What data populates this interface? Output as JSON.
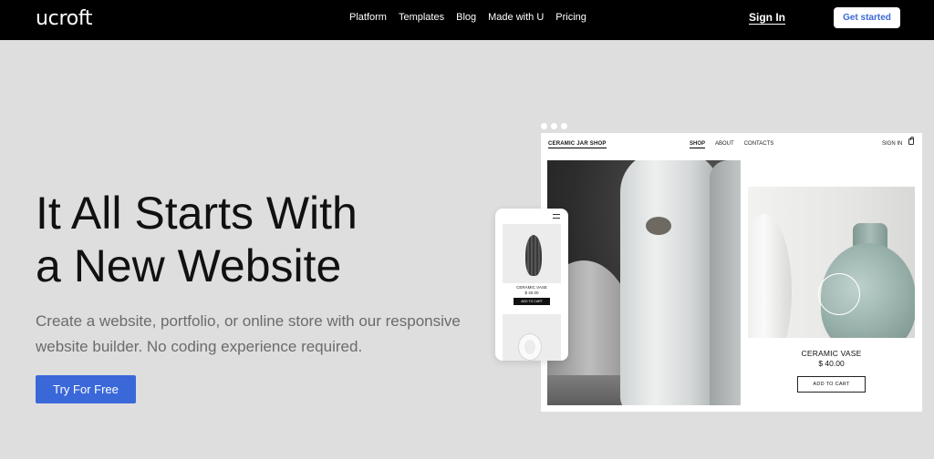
{
  "header": {
    "logo": "ucroft",
    "nav": [
      "Platform",
      "Templates",
      "Blog",
      "Made with U",
      "Pricing"
    ],
    "sign_in": "Sign In",
    "get_started": "Get started"
  },
  "hero": {
    "headline_line1": "It All Starts With",
    "headline_line2": "a New Website",
    "subtext": "Create a website, portfolio, or online store with our responsive website builder. No coding experience required.",
    "cta": "Try For Free"
  },
  "mockup": {
    "shop_logo": "CERAMIC JAR SHOP",
    "shop_nav": [
      "SHOP",
      "ABOUT",
      "CONTACTS"
    ],
    "shop_sign_in": "SIGN IN",
    "product_name": "CERAMIC VASE",
    "product_price": "$ 40.00",
    "add_to_cart": "ADD TO CART",
    "phone_product_name": "CERAMIC VASE",
    "phone_product_price": "$ 40.00",
    "phone_add_to_cart": "ADD TO CART"
  },
  "colors": {
    "accent": "#3b68d9",
    "topbar": "#000000",
    "background": "#dedede"
  }
}
